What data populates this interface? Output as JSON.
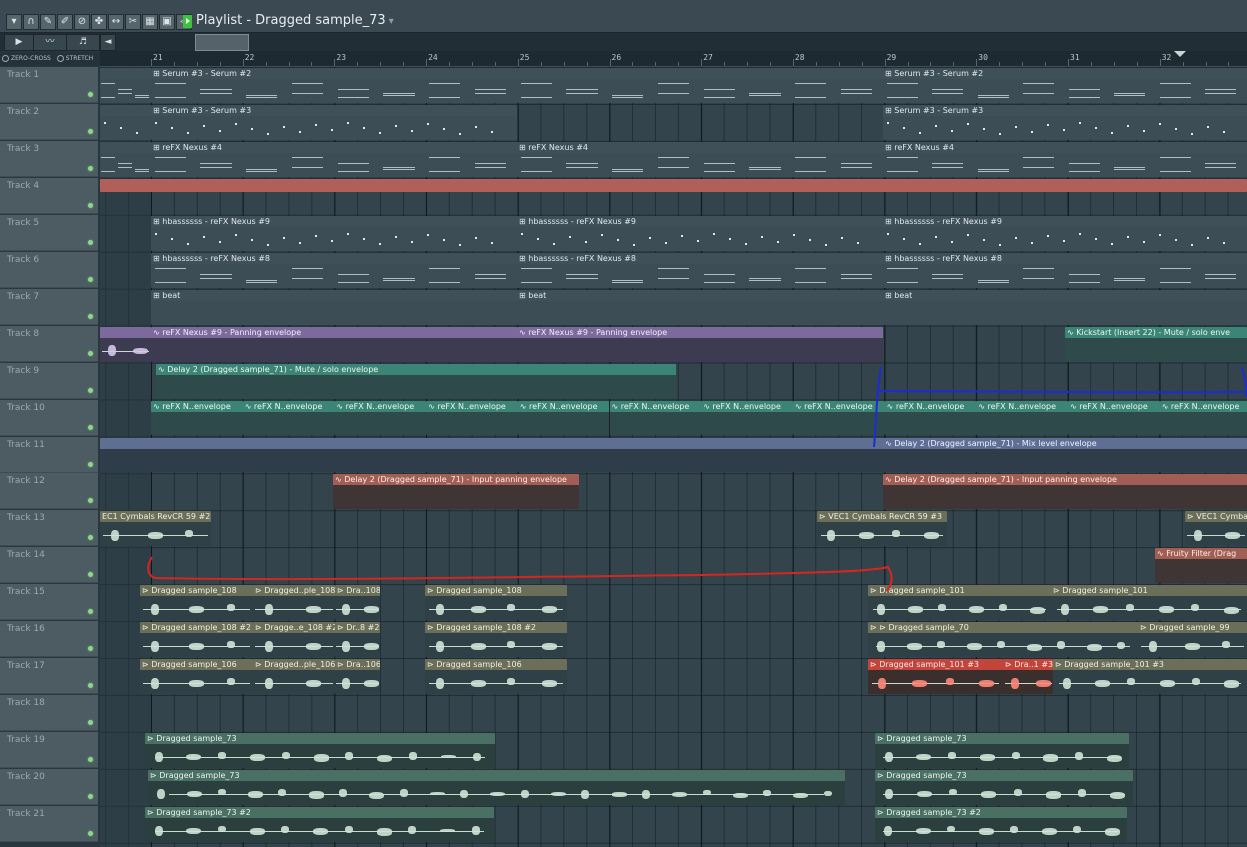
{
  "window": {
    "title": "Playlist - Dragged sample_73",
    "toolbar_icons": [
      "menu-icon",
      "magnet-icon",
      "pencil-icon",
      "brush-icon",
      "delete-icon",
      "mute-icon",
      "slip-icon",
      "slice-icon",
      "select-icon",
      "zoom-icon",
      "playback-icon"
    ]
  },
  "toolrow": {
    "left_arrow": "◄"
  },
  "options": {
    "zero_cross": "ZERO-CROSS",
    "stretch": "STRETCH"
  },
  "ruler": {
    "bars": [
      "21",
      "22",
      "23",
      "24",
      "25",
      "26",
      "27",
      "28",
      "29",
      "30",
      "31",
      "32"
    ]
  },
  "tracks": [
    "Track 1",
    "Track 2",
    "Track 3",
    "Track 4",
    "Track 5",
    "Track 6",
    "Track 7",
    "Track 8",
    "Track 9",
    "Track 10",
    "Track 11",
    "Track 12",
    "Track 13",
    "Track 14",
    "Track 15",
    "Track 16",
    "Track 17",
    "Track 18",
    "Track 19",
    "Track 20",
    "Track 21"
  ],
  "clips": {
    "serum2": "Serum #3 - Serum #2",
    "serum3": "Serum #3 - Serum #3",
    "nexus4": "reFX Nexus #4",
    "hbass9": "hbassssss - reFX Nexus #9",
    "hbass8": "hbassssss - reFX Nexus #8",
    "beat": "beat",
    "nexus_pan": "reFX Nexus #9 - Panning envelope",
    "kickstart": "Kickstart (Insert 22) - Mute / solo enve",
    "delay_mute": "Delay 2 (Dragged sample_71) - Mute / solo envelope",
    "nexus_env": "reFX N..envelope",
    "delay_mix": "Delay 2 (Dragged sample_71) - Mix level envelope",
    "delay_input_pan": "Delay 2 (Dragged sample_71) - Input panning envelope",
    "vec_cym2": "EC1 Cymbals RevCR 59 #2",
    "vec_cym3": "VEC1 Cymbals RevCR 59 #3",
    "vec_cymba": "VEC1 Cymba",
    "fruity": "Fruity Filter (Drag",
    "ds108": "Dragged sample_108",
    "ds108_short": "Dragged..ple_108",
    "dra108": "Dra..108",
    "ds108_2": "Dragged sample_108 #2",
    "dragge108_2": "Dragge..e_108 #2",
    "dr8_2": "Dr..8 #2",
    "ds106": "Dragged sample_106",
    "ds106_short": "Dragged..ple_106",
    "dra106": "Dra..106",
    "ds101": "Dragged sample_101",
    "ds70": "Dragged sample_70",
    "ds99": "Dragged sample_99",
    "ds101_3": "Dragged sample_101 #3",
    "dra1_3": "Dra..1 #3",
    "ds73": "Dragged sample_73",
    "ds73_2": "Dragged sample_73 #2"
  },
  "colors": {
    "pattern": "#3f5059",
    "audio_olive": "#6b6e58",
    "audio_green": "#4a7063",
    "audio_red": "#c2453c",
    "env_teal": "#3c8576",
    "env_purple": "#7c6a9c",
    "env_red": "#a05e55",
    "env_slate": "#5f6f93",
    "track4": "#b06058",
    "drawing_red": "#d6261f",
    "drawing_blue": "#1c2bd6"
  }
}
